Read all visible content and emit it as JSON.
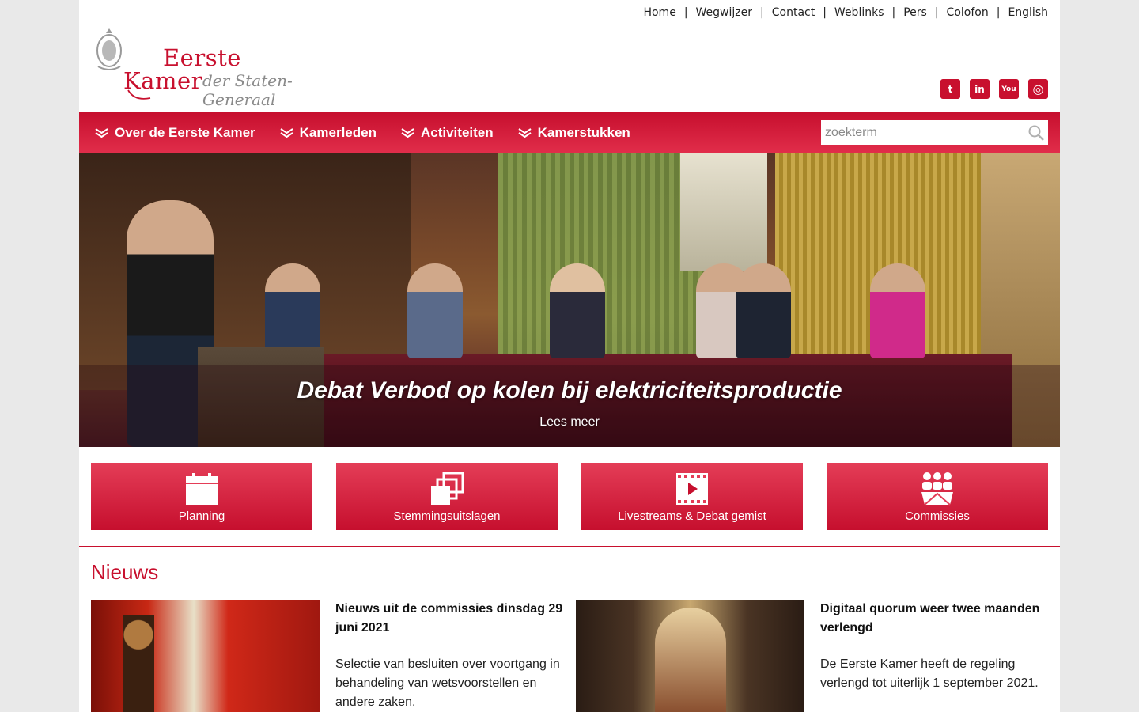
{
  "top_links": [
    "Home",
    "Wegwijzer",
    "Contact",
    "Weblinks",
    "Pers",
    "Colofon",
    "English"
  ],
  "logo": {
    "line1": "Eerste",
    "line2": "Kamer",
    "line3": "der Staten-Generaal"
  },
  "social": [
    {
      "icon": "twitter-icon",
      "glyph": "t"
    },
    {
      "icon": "linkedin-icon",
      "glyph": "in"
    },
    {
      "icon": "youtube-icon",
      "glyph": "You"
    },
    {
      "icon": "instagram-icon",
      "glyph": "◎"
    }
  ],
  "nav": {
    "items": [
      "Over de Eerste Kamer",
      "Kamerleden",
      "Activiteiten",
      "Kamerstukken"
    ]
  },
  "search": {
    "placeholder": "zoekterm",
    "value": ""
  },
  "hero": {
    "title": "Debat Verbod op kolen bij elektriciteitsproductie",
    "link": "Lees meer"
  },
  "tiles": [
    {
      "label": "Planning",
      "icon": "calendar-icon"
    },
    {
      "label": "Stemmingsuitslagen",
      "icon": "stack-icon"
    },
    {
      "label": "Livestreams & Debat gemist",
      "icon": "video-play-icon"
    },
    {
      "label": "Commissies",
      "icon": "committee-icon"
    }
  ],
  "news": {
    "title": "Nieuws",
    "items": [
      {
        "headline": "Nieuws uit de commissies dinsdag 29 juni 2021",
        "summary": "Selectie van besluiten over voortgang in behandeling van wetsvoorstellen en andere zaken."
      },
      {
        "headline": "Digitaal quorum weer twee maanden verlengd",
        "summary": "De Eerste Kamer heeft de regeling verlengd tot uiterlijk 1 september 2021."
      }
    ]
  },
  "colors": {
    "brand": "#c8102e",
    "grey_text": "#8a8a8a"
  }
}
